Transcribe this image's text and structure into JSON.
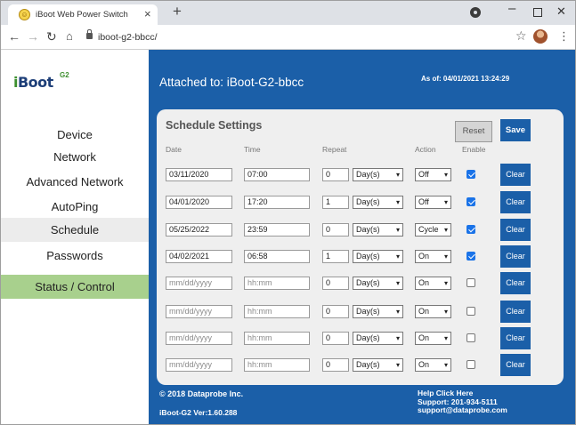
{
  "browser": {
    "tab_title": "iBoot Web Power Switch",
    "tab_close": "×",
    "new_tab": "+",
    "url": "iboot-g2-bbcc/",
    "icons": {
      "favicon": "iboot-favicon",
      "back": "arrow-left-icon",
      "forward": "arrow-right-icon",
      "reload": "reload-icon",
      "home": "home-icon",
      "lock": "lock-icon",
      "star": "star-icon",
      "menu": "menu-dots-icon"
    }
  },
  "logo": {
    "brand": "Boot",
    "brand_prefix": "i",
    "badge": "G2"
  },
  "sidebar": {
    "items": [
      {
        "label": "Device",
        "active": false
      },
      {
        "label": "Network",
        "active": false
      },
      {
        "label": "Advanced Network",
        "active": false
      },
      {
        "label": "AutoPing",
        "active": false
      },
      {
        "label": "Schedule",
        "active": true
      },
      {
        "label": "Passwords",
        "active": false
      }
    ],
    "status_label": "Status / Control"
  },
  "header": {
    "attached": "Attached to: iBoot-G2-bbcc",
    "as_of": "As of: 04/01/2021 13:24:29"
  },
  "schedule": {
    "title": "Schedule Settings",
    "reset_label": "Reset",
    "save_label": "Save",
    "clear_label": "Clear",
    "columns": [
      "Date",
      "Time",
      "Repeat",
      "Action",
      "Enable"
    ],
    "date_placeholder": "mm/dd/yyyy",
    "time_placeholder": "hh:mm",
    "rows": [
      {
        "date": "03/11/2020",
        "time": "07:00",
        "repeat": "0",
        "unit": "Day(s)",
        "action": "Off",
        "enabled": true
      },
      {
        "date": "04/01/2020",
        "time": "17:20",
        "repeat": "1",
        "unit": "Day(s)",
        "action": "Off",
        "enabled": true
      },
      {
        "date": "05/25/2022",
        "time": "23:59",
        "repeat": "0",
        "unit": "Day(s)",
        "action": "Cycle",
        "enabled": true
      },
      {
        "date": "04/02/2021",
        "time": "06:58",
        "repeat": "1",
        "unit": "Day(s)",
        "action": "On",
        "enabled": true
      },
      {
        "date": "",
        "time": "",
        "repeat": "0",
        "unit": "Day(s)",
        "action": "On",
        "enabled": false
      },
      {
        "date": "",
        "time": "",
        "repeat": "0",
        "unit": "Day(s)",
        "action": "On",
        "enabled": false
      },
      {
        "date": "",
        "time": "",
        "repeat": "0",
        "unit": "Day(s)",
        "action": "On",
        "enabled": false
      },
      {
        "date": "",
        "time": "",
        "repeat": "0",
        "unit": "Day(s)",
        "action": "On",
        "enabled": false
      }
    ]
  },
  "footer": {
    "copyright": "© 2018 Dataprobe Inc.",
    "version": "iBoot-G2 Ver:1.60.288",
    "help": "Help Click Here",
    "support_phone": "Support: 201-934-5111",
    "support_email": "support@dataprobe.com"
  },
  "colors": {
    "primary_blue": "#1b5fa8",
    "status_green": "#a8d08d",
    "card_bg": "#efefef",
    "checkbox_blue": "#1a73e8"
  }
}
